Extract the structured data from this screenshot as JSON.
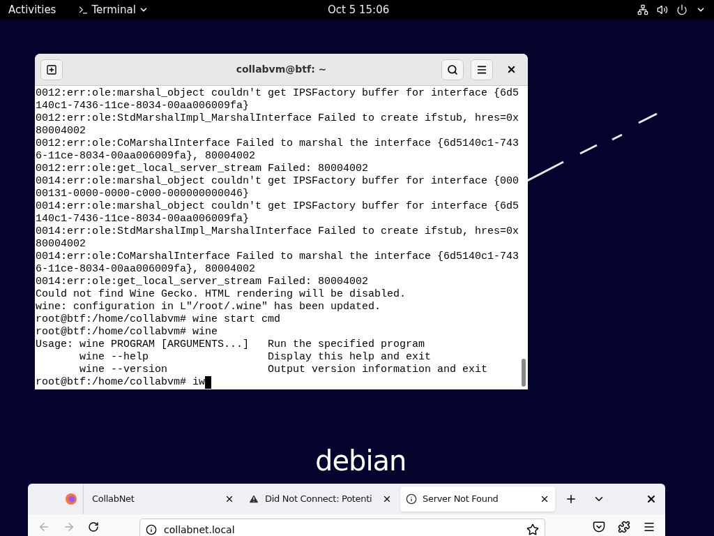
{
  "top_bar": {
    "activities": "Activities",
    "app_menu": "Terminal",
    "clock": "Oct 5  15:06"
  },
  "terminal": {
    "title": "collabvm@btf: ~",
    "lines": [
      "0012:err:ole:marshal_object couldn't get IPSFactory buffer for interface {6d5",
      "140c1-7436-11ce-8034-00aa006009fa}",
      "0012:err:ole:StdMarshalImpl_MarshalInterface Failed to create ifstub, hres=0x",
      "80004002",
      "0012:err:ole:CoMarshalInterface Failed to marshal the interface {6d5140c1-743",
      "6-11ce-8034-00aa006009fa}, 80004002",
      "0012:err:ole:get_local_server_stream Failed: 80004002",
      "0014:err:ole:marshal_object couldn't get IPSFactory buffer for interface {000",
      "00131-0000-0000-c000-000000000046}",
      "0014:err:ole:marshal_object couldn't get IPSFactory buffer for interface {6d5",
      "140c1-7436-11ce-8034-00aa006009fa}",
      "0014:err:ole:StdMarshalImpl_MarshalInterface Failed to create ifstub, hres=0x",
      "80004002",
      "0014:err:ole:CoMarshalInterface Failed to marshal the interface {6d5140c1-743",
      "6-11ce-8034-00aa006009fa}, 80004002",
      "0014:err:ole:get_local_server_stream Failed: 80004002",
      "Could not find Wine Gecko. HTML rendering will be disabled.",
      "wine: configuration in L\"/root/.wine\" has been updated.",
      "root@btf:/home/collabvm# wine start cmd",
      "root@btf:/home/collabvm# wine",
      "Usage: wine PROGRAM [ARGUMENTS...]   Run the specified program",
      "       wine --help                   Display this help and exit",
      "       wine --version                Output version information and exit"
    ],
    "prompt": "root@btf:/home/collabvm# iw"
  },
  "logo": "debian",
  "browser": {
    "tabs": [
      {
        "kind": "plain",
        "label": "CollabNet",
        "selected": false
      },
      {
        "kind": "warning",
        "label": "Did Not Connect: Potenti",
        "selected": false
      },
      {
        "kind": "info",
        "label": "Server Not Found",
        "selected": true
      }
    ],
    "url": "collabnet.local"
  }
}
